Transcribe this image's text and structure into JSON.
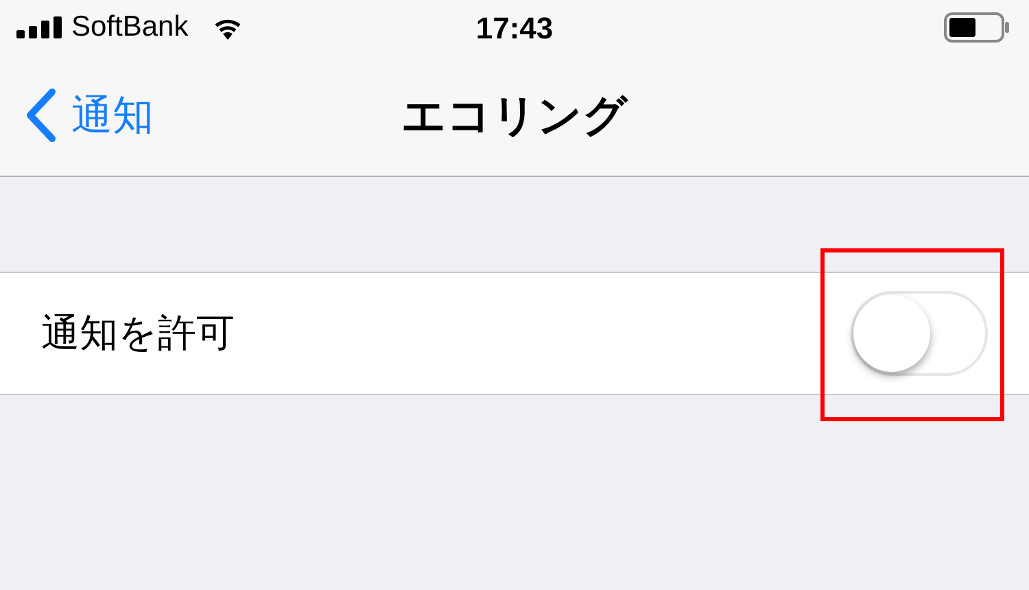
{
  "status_bar": {
    "carrier": "SoftBank",
    "time": "17:43"
  },
  "nav": {
    "back": "通知",
    "title": "エコリング"
  },
  "settings": [
    {
      "label": "通知を許可",
      "on": false,
      "highlighted": true
    }
  ]
}
